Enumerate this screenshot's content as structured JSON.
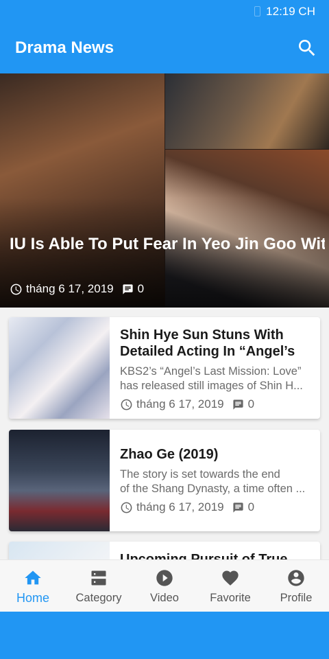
{
  "status_bar": {
    "time": "12:19 CH"
  },
  "app_bar": {
    "title": "Drama News",
    "search_icon": "search-icon"
  },
  "featured": {
    "title": "IU Is Able To Put Fear In Yeo Jin Goo With Just Her Presence In “Hotel Del",
    "date": "tháng 6 17, 2019",
    "comments": "0"
  },
  "articles": [
    {
      "title": "Shin Hye Sun Stuns With Detailed Acting In “Angel’s",
      "excerpt_line1": "KBS2’s “Angel’s Last Mission: Love”",
      "excerpt_line2": "has released still images of Shin H...",
      "date": "tháng 6 17, 2019",
      "comments": "0"
    },
    {
      "title": "Zhao Ge (2019)",
      "excerpt_line1": "The story is set towards the end",
      "excerpt_line2": "of the Shang Dynasty, a time often ...",
      "date": "tháng 6 17, 2019",
      "comments": "0"
    },
    {
      "title": "Upcoming Pursuit of True"
    }
  ],
  "bottom_nav": [
    {
      "label": "Home",
      "icon": "home-icon",
      "active": true
    },
    {
      "label": "Category",
      "icon": "category-icon",
      "active": false
    },
    {
      "label": "Video",
      "icon": "play-circle-icon",
      "active": false
    },
    {
      "label": "Favorite",
      "icon": "heart-icon",
      "active": false
    },
    {
      "label": "Profile",
      "icon": "profile-icon",
      "active": false
    }
  ],
  "colors": {
    "primary": "#2196F3",
    "nav_inactive": "#555555",
    "card_bg": "#ffffff"
  }
}
